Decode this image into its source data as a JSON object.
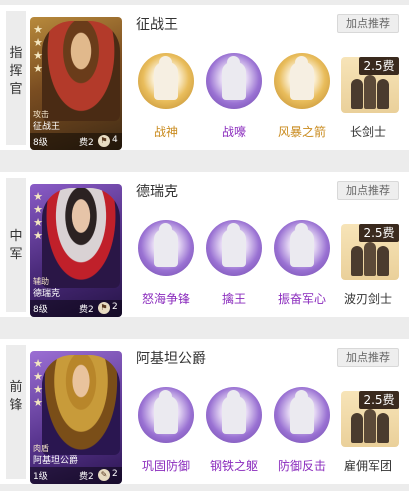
{
  "rows": [
    {
      "role": [
        "指",
        "挥",
        "官"
      ],
      "hero": {
        "name": "征战王",
        "type": "攻击",
        "card_name": "征战王",
        "level": "8级",
        "cost": "费2",
        "badge": "4",
        "stars": 4
      },
      "recommend_label": "加点推荐",
      "skills": [
        {
          "label": "战神",
          "icon": "warrior-icon"
        },
        {
          "label": "战嚎",
          "icon": "war-cry-icon"
        },
        {
          "label": "风暴之箭",
          "icon": "storm-arrow-icon"
        }
      ],
      "troop": {
        "name": "长剑士",
        "cost": "2.5费"
      }
    },
    {
      "role": [
        "中",
        "军"
      ],
      "hero": {
        "name": "德瑞克",
        "type": "辅助",
        "card_name": "德瑞克",
        "level": "8级",
        "cost": "费2",
        "badge": "2",
        "stars": 4
      },
      "recommend_label": "加点推荐",
      "skills": [
        {
          "label": "怒海争锋",
          "icon": "sea-fury-icon"
        },
        {
          "label": "擒王",
          "icon": "capture-king-icon"
        },
        {
          "label": "振奋军心",
          "icon": "rally-icon"
        }
      ],
      "troop": {
        "name": "波刃剑士",
        "cost": "2.5费"
      }
    },
    {
      "role": [
        "前",
        "锋"
      ],
      "hero": {
        "name": "阿基坦公爵",
        "type": "肉盾",
        "card_name": "阿基坦公爵",
        "level": "1级",
        "cost": "费2",
        "badge": "2",
        "stars": 4
      },
      "recommend_label": "加点推荐",
      "skills": [
        {
          "label": "巩固防御",
          "icon": "fortify-icon"
        },
        {
          "label": "钢铁之躯",
          "icon": "iron-body-icon"
        },
        {
          "label": "防御反击",
          "icon": "counter-icon"
        }
      ],
      "troop": {
        "name": "雇佣军团",
        "cost": "2.5费"
      }
    }
  ],
  "colors": {
    "gold": "#c98a1c",
    "purple": "#8a2bbd"
  }
}
